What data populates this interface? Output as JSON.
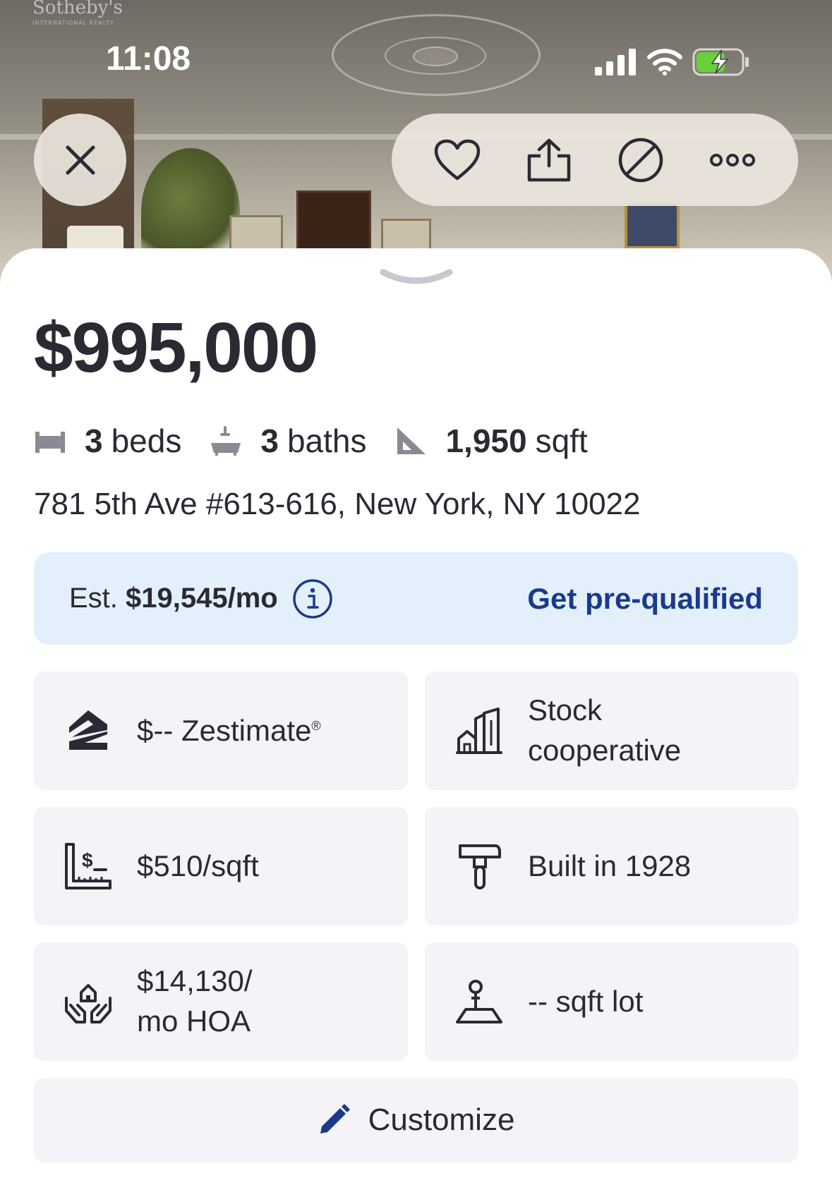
{
  "status_bar": {
    "time": "11:08"
  },
  "hero": {
    "watermark": "Sotheby's",
    "watermark_sub": "INTERNATIONAL REALTY"
  },
  "top_actions": {
    "close_icon": "close-icon",
    "icons": [
      "heart-icon",
      "share-icon",
      "hide-icon",
      "more-icon"
    ]
  },
  "listing": {
    "price": "$995,000",
    "beds_num": "3",
    "beds_label": "beds",
    "baths_num": "3",
    "baths_label": "baths",
    "sqft_num": "1,950",
    "sqft_label": "sqft",
    "address": "781 5th Ave #613-616, New York, NY 10022"
  },
  "payment": {
    "est_prefix": "Est.",
    "est_value": "$19,545/mo",
    "cta": "Get pre-qualified"
  },
  "tiles": {
    "zestimate": "$-- Zestimate",
    "zestimate_mark": "®",
    "home_type_line1": "Stock",
    "home_type_line2": "cooperative",
    "price_per_sqft": "$510/sqft",
    "built": "Built in 1928",
    "hoa_line1": "$14,130/",
    "hoa_line2": "mo HOA",
    "lot": "-- sqft lot"
  },
  "customize": {
    "label": "Customize"
  },
  "colors": {
    "accent": "#1b3a8c",
    "payment_bg": "#e3f0fb",
    "tile_bg": "#f3f3f8",
    "text": "#2a2a33",
    "battery": "#6ad03a"
  }
}
